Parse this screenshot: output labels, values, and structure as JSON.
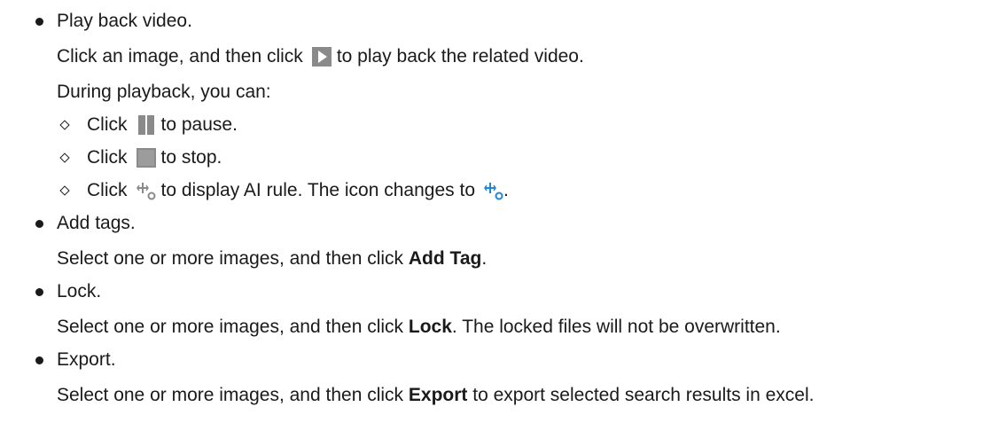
{
  "items": {
    "play": {
      "title": "Play back video.",
      "desc_before": "Click an image, and then click",
      "desc_after": "to play back the related video.",
      "during": "During playback, you can:",
      "sub": [
        {
          "pre": "Click",
          "post": "to pause.",
          "icon": "pause-icon"
        },
        {
          "pre": "Click",
          "post": "to stop.",
          "icon": "stop-icon"
        },
        {
          "pre": "Click",
          "post": "to display AI rule. The icon changes to",
          "icon": "ai-rule-icon",
          "icon2": "ai-rule-active-icon",
          "end": "."
        }
      ]
    },
    "tags": {
      "title": "Add tags.",
      "desc_before": "Select one or more images, and then click",
      "bold": "Add Tag",
      "desc_after": "."
    },
    "lock": {
      "title": "Lock.",
      "desc_before": "Select one or more images, and then click",
      "bold": "Lock",
      "desc_after": ". The locked files will not be overwritten."
    },
    "export": {
      "title": "Export.",
      "desc_before": "Select one or more images, and then click",
      "bold": "Export",
      "desc_after": "to export selected search results in excel."
    }
  },
  "colors": {
    "text": "#1a1a1a",
    "icon_gray": "#8a8a8a",
    "icon_blue": "#1e88d8"
  }
}
